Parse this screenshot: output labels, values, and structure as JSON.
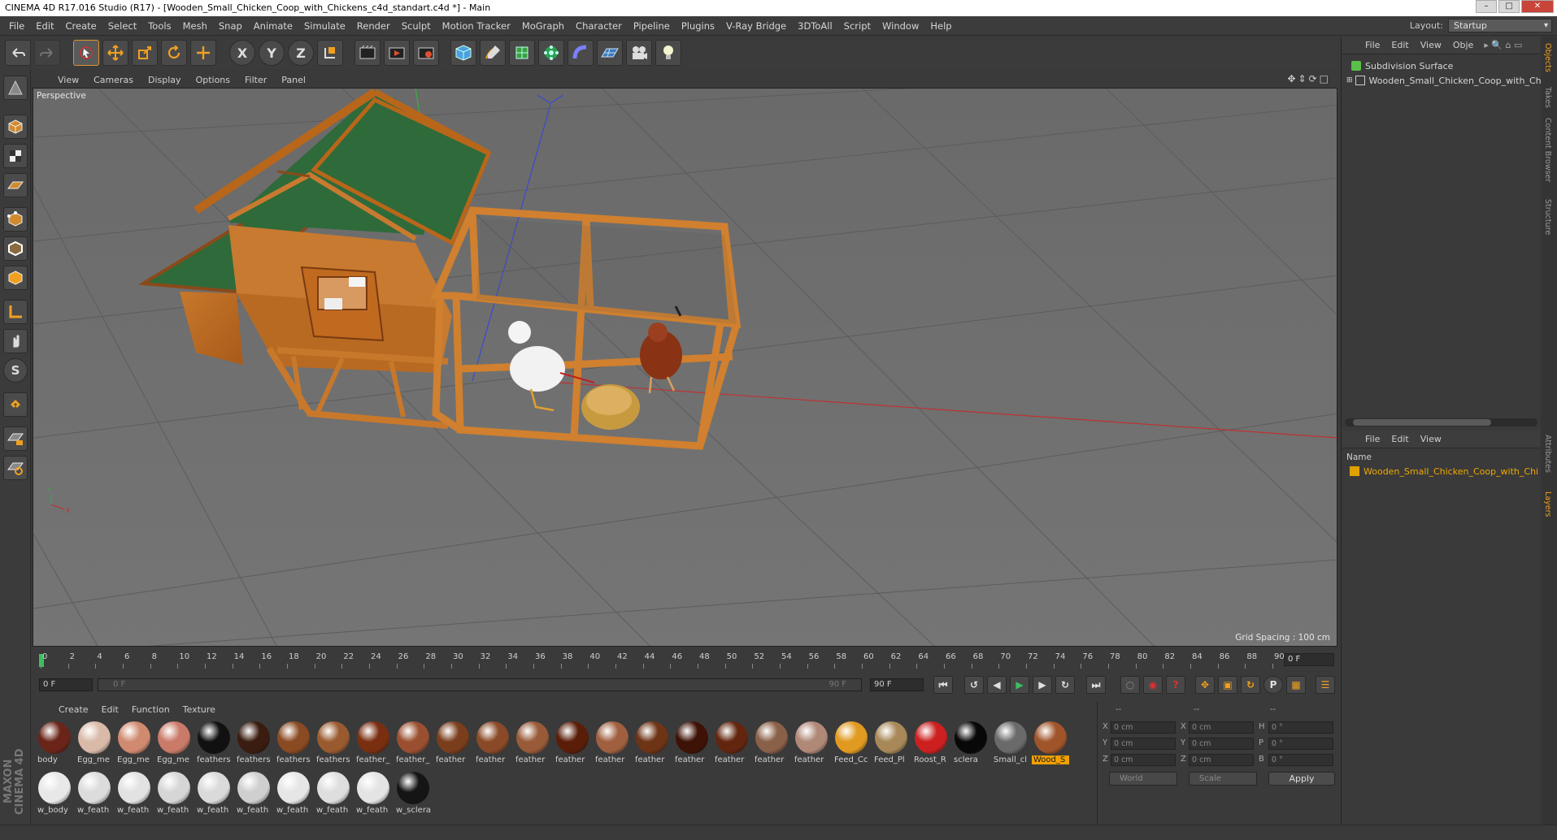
{
  "window": {
    "title": "CINEMA 4D R17.016 Studio (R17) - [Wooden_Small_Chicken_Coop_with_Chickens_c4d_standart.c4d *] - Main",
    "controls": [
      "minimize-icon",
      "maximize-icon",
      "close-icon"
    ]
  },
  "menubar": {
    "items": [
      "File",
      "Edit",
      "Create",
      "Select",
      "Tools",
      "Mesh",
      "Snap",
      "Animate",
      "Simulate",
      "Render",
      "Sculpt",
      "Motion Tracker",
      "MoGraph",
      "Character",
      "Pipeline",
      "Plugins",
      "V-Ray Bridge",
      "3DToAll",
      "Script",
      "Window",
      "Help"
    ],
    "layout_label": "Layout:",
    "layout_value": "Startup"
  },
  "toolbar": {
    "x_label": "X",
    "y_label": "Y",
    "z_label": "Z"
  },
  "left_tools": {
    "s_label": "S"
  },
  "viewport": {
    "menu": [
      "View",
      "Cameras",
      "Display",
      "Options",
      "Filter",
      "Panel"
    ],
    "label": "Perspective",
    "grid_spacing": "Grid Spacing : 100 cm",
    "axis_labels": {
      "y": "Y",
      "x": "X"
    }
  },
  "timeline": {
    "ticks": [
      "0",
      "2",
      "4",
      "6",
      "8",
      "10",
      "12",
      "14",
      "16",
      "18",
      "20",
      "22",
      "24",
      "26",
      "28",
      "30",
      "32",
      "34",
      "36",
      "38",
      "40",
      "42",
      "44",
      "46",
      "48",
      "50",
      "52",
      "54",
      "56",
      "58",
      "60",
      "62",
      "64",
      "66",
      "68",
      "70",
      "72",
      "74",
      "76",
      "78",
      "80",
      "82",
      "84",
      "86",
      "88",
      "90"
    ],
    "current_frame_field": "0 F",
    "start_field": "0 F",
    "range_start": "0 F",
    "range_end": "90 F",
    "end_field": "90 F",
    "p_label": "P"
  },
  "material_manager": {
    "menu": [
      "Create",
      "Edit",
      "Function",
      "Texture"
    ],
    "row1": [
      {
        "label": "body",
        "color": "#6a2418"
      },
      {
        "label": "Egg_me",
        "color": "#d9b9a8"
      },
      {
        "label": "Egg_me",
        "color": "#d08a70"
      },
      {
        "label": "Egg_me",
        "color": "#c97a68"
      },
      {
        "label": "feathers",
        "color": "#111111"
      },
      {
        "label": "feathers",
        "color": "#3a1c10"
      },
      {
        "label": "feathers",
        "color": "#8a4a22"
      },
      {
        "label": "feathers",
        "color": "#9a5a30"
      },
      {
        "label": "feather_",
        "color": "#7a2e10"
      },
      {
        "label": "feather_",
        "color": "#9a5030"
      },
      {
        "label": "feather",
        "color": "#7a3e1c"
      },
      {
        "label": "feather",
        "color": "#8a4a28"
      },
      {
        "label": "feather",
        "color": "#985a38"
      },
      {
        "label": "feather",
        "color": "#5a1e08"
      },
      {
        "label": "feather",
        "color": "#a06040"
      },
      {
        "label": "feather",
        "color": "#6e3416"
      },
      {
        "label": "feather",
        "color": "#3e1206"
      },
      {
        "label": "feather",
        "color": "#62260e"
      },
      {
        "label": "feather",
        "color": "#8a6048"
      },
      {
        "label": "feather",
        "color": "#b08878"
      },
      {
        "label": "Feed_Cc",
        "color": "#e09a20"
      },
      {
        "label": "Feed_Pl",
        "color": "#a88858"
      },
      {
        "label": "Roost_R",
        "color": "#cc2020"
      },
      {
        "label": "sclera",
        "color": "#080808"
      },
      {
        "label": "Small_cl",
        "color": "#6a6a6a"
      },
      {
        "label": "Wood_S",
        "color": "#a0542a",
        "selected": true
      }
    ],
    "row2": [
      {
        "label": "w_body",
        "color": "#e8e8e8"
      },
      {
        "label": "w_feath",
        "color": "#dcdcdc"
      },
      {
        "label": "w_feath",
        "color": "#e2e2e2"
      },
      {
        "label": "w_feath",
        "color": "#d6d6d6"
      },
      {
        "label": "w_feath",
        "color": "#dadada"
      },
      {
        "label": "w_feath",
        "color": "#cfcfcf"
      },
      {
        "label": "w_feath",
        "color": "#e6e6e6"
      },
      {
        "label": "w_feath",
        "color": "#dedede"
      },
      {
        "label": "w_feath",
        "color": "#e4e4e4"
      },
      {
        "label": "w_sclera",
        "color": "#151515"
      }
    ]
  },
  "coordinates": {
    "header": [
      "--",
      "--",
      "--"
    ],
    "rows": [
      {
        "a": "X",
        "av": "0 cm",
        "b": "X",
        "bv": "0 cm",
        "c": "H",
        "cv": "0 °"
      },
      {
        "a": "Y",
        "av": "0 cm",
        "b": "Y",
        "bv": "0 cm",
        "c": "P",
        "cv": "0 °"
      },
      {
        "a": "Z",
        "av": "0 cm",
        "b": "Z",
        "bv": "0 cm",
        "c": "B",
        "cv": "0 °"
      }
    ],
    "world": "World",
    "scale": "Scale",
    "apply": "Apply"
  },
  "object_manager": {
    "menu": [
      "File",
      "Edit",
      "View",
      "Obje"
    ],
    "items": [
      {
        "label": "Subdivision Surface",
        "color": "#5bc04a"
      },
      {
        "label": "Wooden_Small_Chicken_Coop_with_Chic",
        "color": "#cccccc"
      }
    ]
  },
  "layer_manager": {
    "menu": [
      "File",
      "Edit",
      "View"
    ],
    "column": "Name",
    "items": [
      {
        "label": "Wooden_Small_Chicken_Coop_with_Chi",
        "color": "#e0a000"
      }
    ]
  },
  "right_tabs": [
    "Objects",
    "Takes",
    "Content Browser",
    "Structure",
    "Attributes",
    "Layers"
  ],
  "branding": "MAXON CINEMA 4D",
  "colors": {
    "accent": "#f0a000",
    "viewport": "#6e6e6e",
    "panel": "#3a3a3a"
  }
}
